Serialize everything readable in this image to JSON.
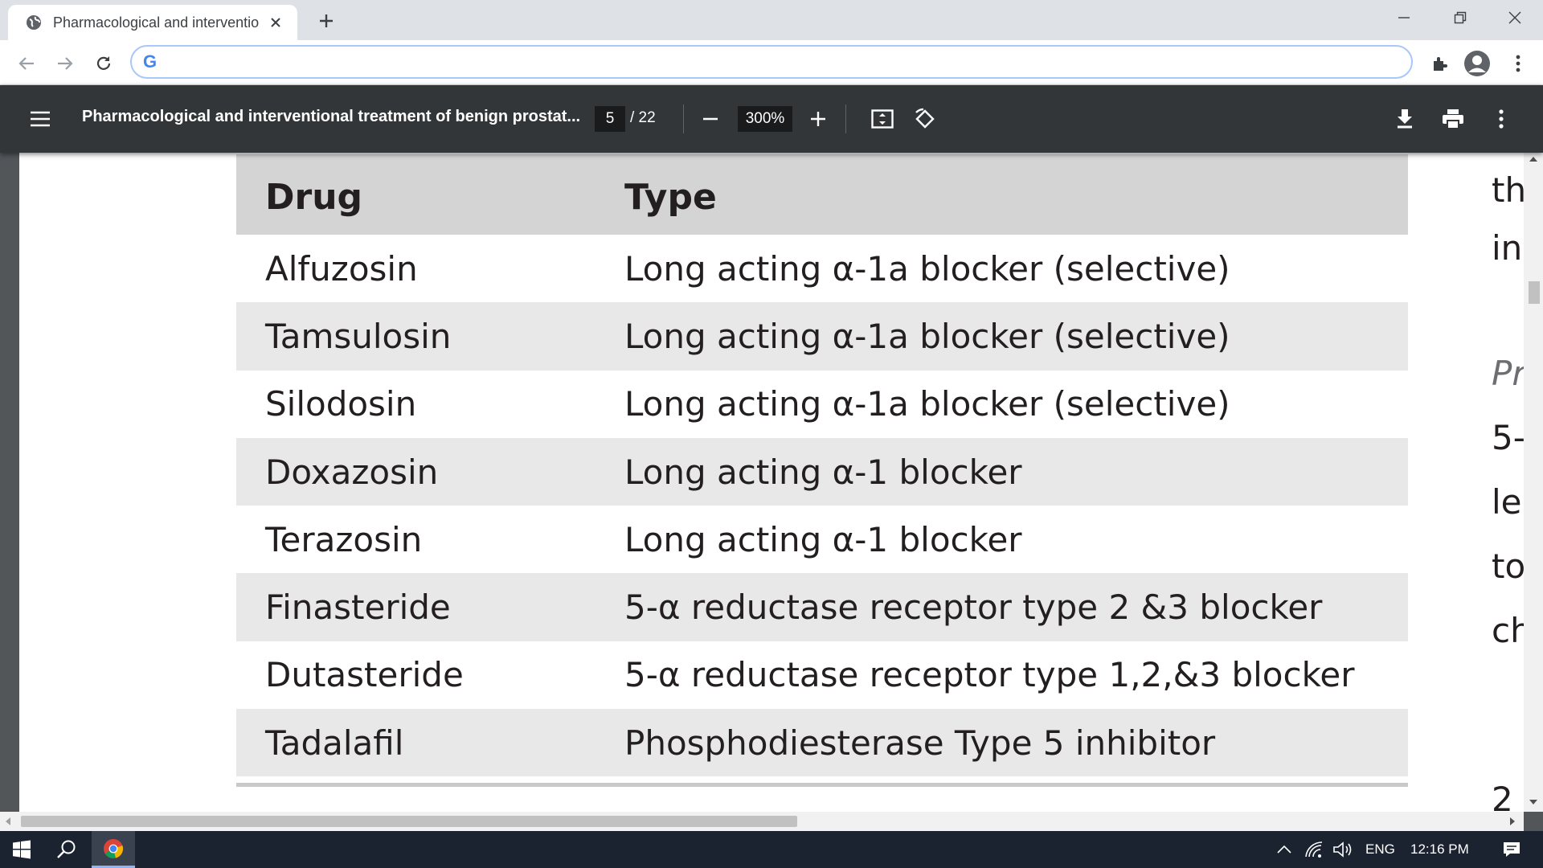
{
  "browser": {
    "tab_title": "Pharmacological and interventio",
    "omnibox_value": "",
    "icons": [
      "globe-icon",
      "close-icon",
      "plus-icon",
      "minimize-icon",
      "restore-icon",
      "close-window-icon",
      "back-arrow-icon",
      "forward-arrow-icon",
      "reload-icon",
      "google-icon",
      "extensions-icon",
      "profile-icon",
      "menu-dots-icon"
    ],
    "google_letter": "G"
  },
  "pdf": {
    "title": "Pharmacological and interventional treatment of benign prostat...",
    "current_page": "5",
    "total_pages": "/ 22",
    "zoom": "300%",
    "colors": {
      "toolbar": "#323639",
      "background": "#525659"
    }
  },
  "table": {
    "headers": {
      "drug": "Drug",
      "type": "Type"
    },
    "rows": [
      {
        "drug": "Alfuzosin",
        "type": "Long acting α-1a blocker (selective)"
      },
      {
        "drug": "Tamsulosin",
        "type": "Long acting α-1a blocker (selective)"
      },
      {
        "drug": "Silodosin",
        "type": "Long acting α-1a blocker (selective)"
      },
      {
        "drug": "Doxazosin",
        "type": "Long acting α-1 blocker"
      },
      {
        "drug": "Terazosin",
        "type": "Long acting α-1 blocker"
      },
      {
        "drug": "Finasteride",
        "type": "5-α reductase receptor type 2 &3 blocker"
      },
      {
        "drug": "Dutasteride",
        "type": "5-α reductase receptor type 1,2,&3 blocker"
      },
      {
        "drug": "Tadalafil",
        "type": "Phosphodiesterase Type 5 inhibitor"
      }
    ],
    "colors": {
      "header": "#d4d4d5",
      "alt_row": "#e8e8e9"
    }
  },
  "side_text": [
    "th",
    "in",
    "Pr",
    "5-",
    "le",
    "to",
    "ch",
    "2"
  ],
  "taskbar": {
    "language": "ENG",
    "time": "12:16 PM"
  }
}
